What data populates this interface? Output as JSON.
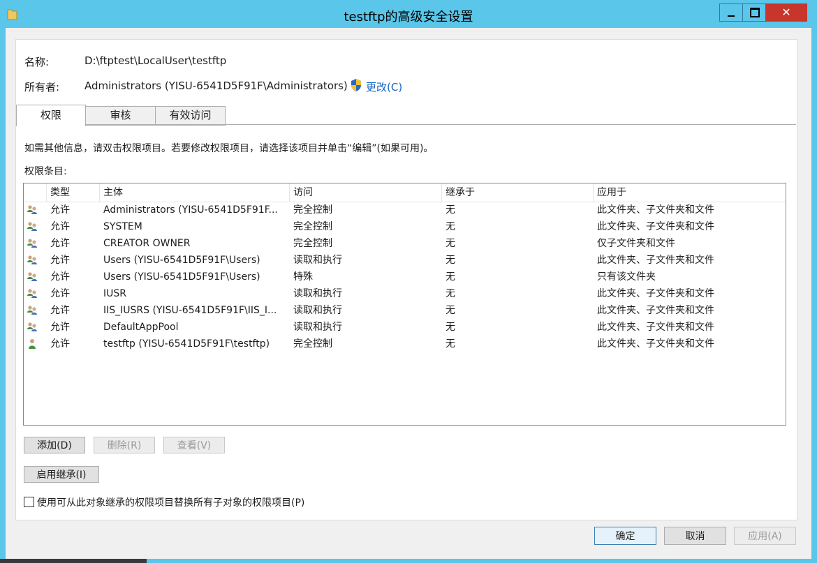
{
  "window": {
    "title": "testftp的高级安全设置"
  },
  "info": {
    "name_label": "名称:",
    "name_value": "D:\\ftptest\\LocalUser\\testftp",
    "owner_label": "所有者:",
    "owner_value": "Administrators (YISU-6541D5F91F\\Administrators)",
    "change_link": "更改(C)"
  },
  "tabs": [
    {
      "label": "权限",
      "active": true
    },
    {
      "label": "审核",
      "active": false
    },
    {
      "label": "有效访问",
      "active": false
    }
  ],
  "instruction": "如需其他信息，请双击权限项目。若要修改权限项目，请选择该项目并单击“编辑”(如果可用)。",
  "entries_label": "权限条目:",
  "table": {
    "headers": [
      "类型",
      "主体",
      "访问",
      "继承于",
      "应用于"
    ],
    "rows": [
      {
        "icon": "group-users-icon",
        "type": "允许",
        "principal": "Administrators (YISU-6541D5F91F...",
        "access": "完全控制",
        "inherited": "无",
        "applies": "此文件夹、子文件夹和文件"
      },
      {
        "icon": "group-users-icon",
        "type": "允许",
        "principal": "SYSTEM",
        "access": "完全控制",
        "inherited": "无",
        "applies": "此文件夹、子文件夹和文件"
      },
      {
        "icon": "group-users-icon",
        "type": "允许",
        "principal": "CREATOR OWNER",
        "access": "完全控制",
        "inherited": "无",
        "applies": "仅子文件夹和文件"
      },
      {
        "icon": "group-users-icon",
        "type": "允许",
        "principal": "Users (YISU-6541D5F91F\\Users)",
        "access": "读取和执行",
        "inherited": "无",
        "applies": "此文件夹、子文件夹和文件"
      },
      {
        "icon": "group-users-icon",
        "type": "允许",
        "principal": "Users (YISU-6541D5F91F\\Users)",
        "access": "特殊",
        "inherited": "无",
        "applies": "只有该文件夹"
      },
      {
        "icon": "group-users-icon",
        "type": "允许",
        "principal": "IUSR",
        "access": "读取和执行",
        "inherited": "无",
        "applies": "此文件夹、子文件夹和文件"
      },
      {
        "icon": "group-users-icon",
        "type": "允许",
        "principal": "IIS_IUSRS (YISU-6541D5F91F\\IIS_I...",
        "access": "读取和执行",
        "inherited": "无",
        "applies": "此文件夹、子文件夹和文件"
      },
      {
        "icon": "group-users-icon",
        "type": "允许",
        "principal": "DefaultAppPool",
        "access": "读取和执行",
        "inherited": "无",
        "applies": "此文件夹、子文件夹和文件"
      },
      {
        "icon": "single-user-icon",
        "type": "允许",
        "principal": "testftp (YISU-6541D5F91F\\testftp)",
        "access": "完全控制",
        "inherited": "无",
        "applies": "此文件夹、子文件夹和文件"
      }
    ]
  },
  "buttons": {
    "add": "添加(D)",
    "remove": "删除(R)",
    "view": "查看(V)",
    "enable_inheritance": "启用继承(I)",
    "ok": "确定",
    "cancel": "取消",
    "apply": "应用(A)"
  },
  "replace_checkbox": {
    "label": "使用可从此对象继承的权限项目替换所有子对象的权限项目(P)",
    "checked": false
  },
  "colors": {
    "titlebar": "#5ac6ea",
    "close": "#c7352b",
    "link": "#1665c1"
  }
}
